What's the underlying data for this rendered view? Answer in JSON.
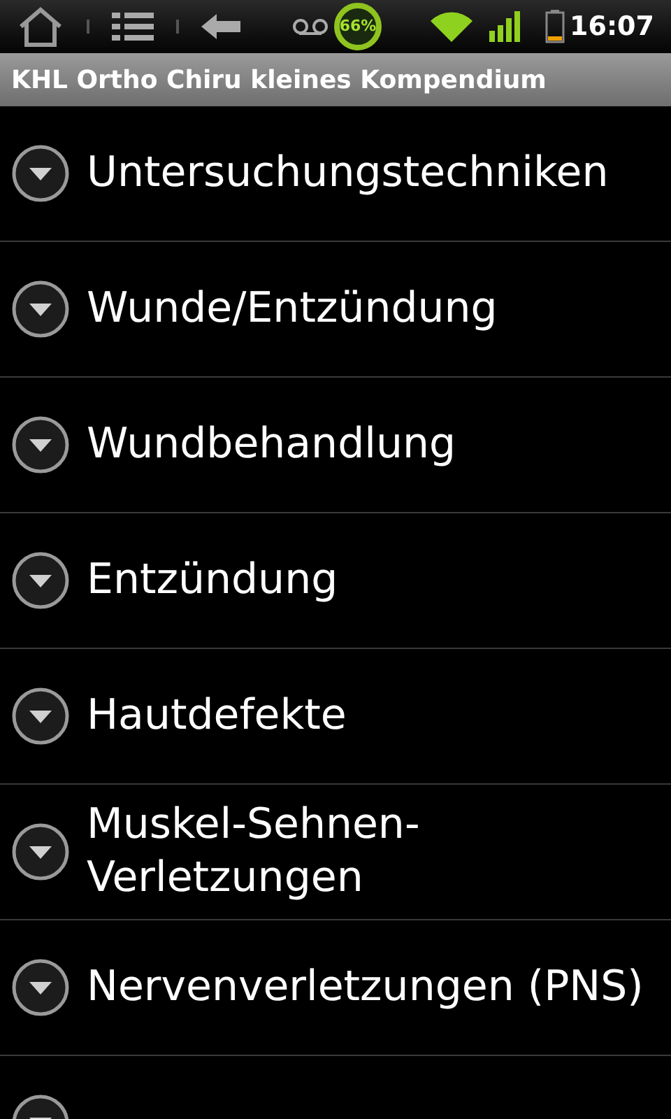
{
  "status_bar": {
    "battery_percent": "66%",
    "time": "16:07"
  },
  "title_bar": {
    "title": "KHL Ortho Chiru kleines Kompendium"
  },
  "sections": [
    {
      "label": "Untersuchungstechniken",
      "expanded": false
    },
    {
      "label": "Wunde/Entzündung",
      "expanded": false
    },
    {
      "label": "Wundbehandlung",
      "expanded": false
    },
    {
      "label": "Entzündung",
      "expanded": false
    },
    {
      "label": "Hautdefekte",
      "expanded": false
    },
    {
      "label": "Muskel-Sehnen-Verletzungen",
      "expanded": false
    },
    {
      "label": "Nervenverletzungen (PNS)",
      "expanded": false
    },
    {
      "expanded": false
    }
  ]
}
